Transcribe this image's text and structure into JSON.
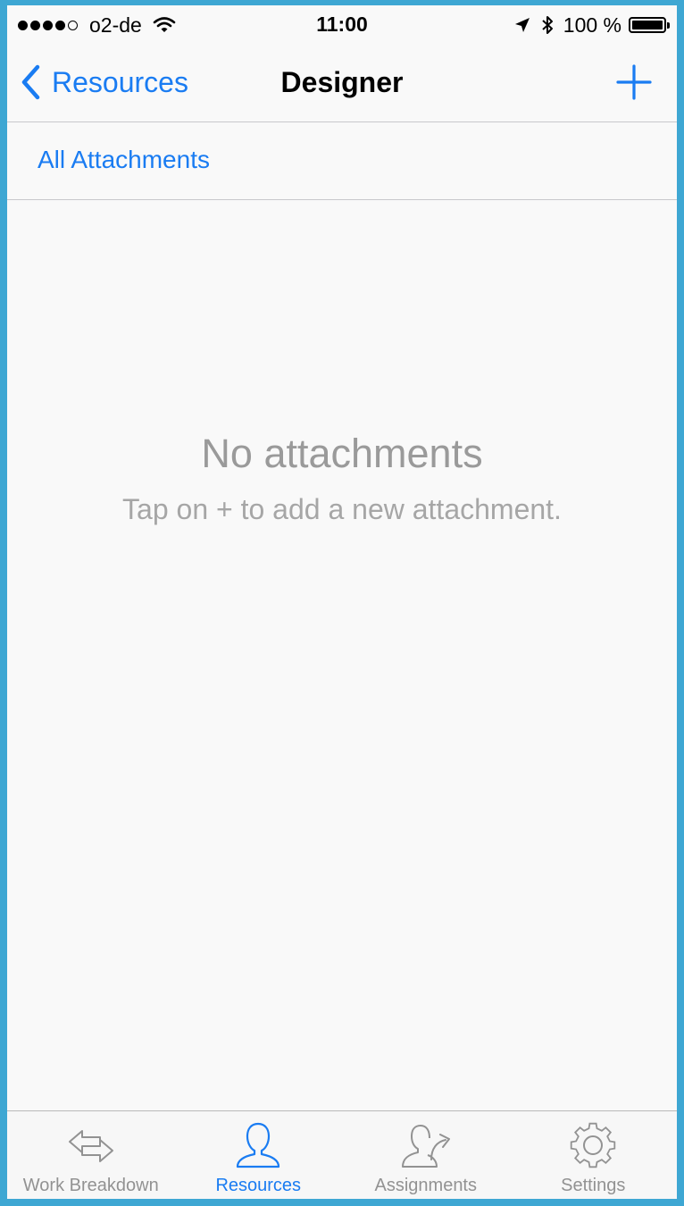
{
  "status_bar": {
    "carrier": "o2-de",
    "signal_bars": 4,
    "signal_total": 5,
    "time": "11:00",
    "battery_text": "100 %",
    "battery_level": 1.0
  },
  "nav": {
    "back_label": "Resources",
    "title": "Designer",
    "add_icon": "plus-icon"
  },
  "filter_row": {
    "label": "All Attachments"
  },
  "empty_state": {
    "title": "No attachments",
    "subtitle": "Tap on + to add a new attachment."
  },
  "tabs": [
    {
      "label": "Work Breakdown",
      "icon": "arrows-exchange-icon",
      "active": false
    },
    {
      "label": "Resources",
      "icon": "person-icon",
      "active": true
    },
    {
      "label": "Assignments",
      "icon": "person-arrow-icon",
      "active": false
    },
    {
      "label": "Settings",
      "icon": "gear-icon",
      "active": false
    }
  ],
  "colors": {
    "accent": "#1a7cf2",
    "inactive": "#929292",
    "frame": "#3ea7d3",
    "background": "#f9f9f9"
  }
}
